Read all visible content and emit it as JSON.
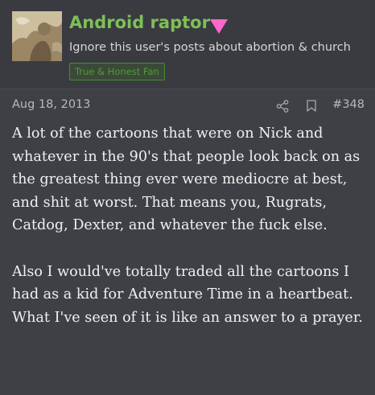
{
  "user": {
    "name": "Android raptor",
    "gender_icon": "female-triangle-icon",
    "gender_color": "#ff66cc",
    "title": "Ignore this user's posts about abortion & church",
    "banner": "True & Honest Fan"
  },
  "post": {
    "date": "Aug 18, 2013",
    "share_icon": "share-icon",
    "bookmark_icon": "bookmark-icon",
    "number": "#348",
    "paragraphs": [
      "A lot of the cartoons that were on Nick and whatever in the 90's that people look back on as the greatest thing ever were mediocre at best, and shit at worst. That means you, Rugrats, Catdog, Dexter, and whatever the fuck else.",
      "Also I would've totally traded all the cartoons I had as a kid for Adventure Time in a heartbeat. What I've seen of it is like an answer to a prayer."
    ]
  },
  "colors": {
    "username": "#7fbf57",
    "banner_text": "#4f9b39",
    "background": "#3e4045",
    "body_text": "#f0f0f0"
  }
}
